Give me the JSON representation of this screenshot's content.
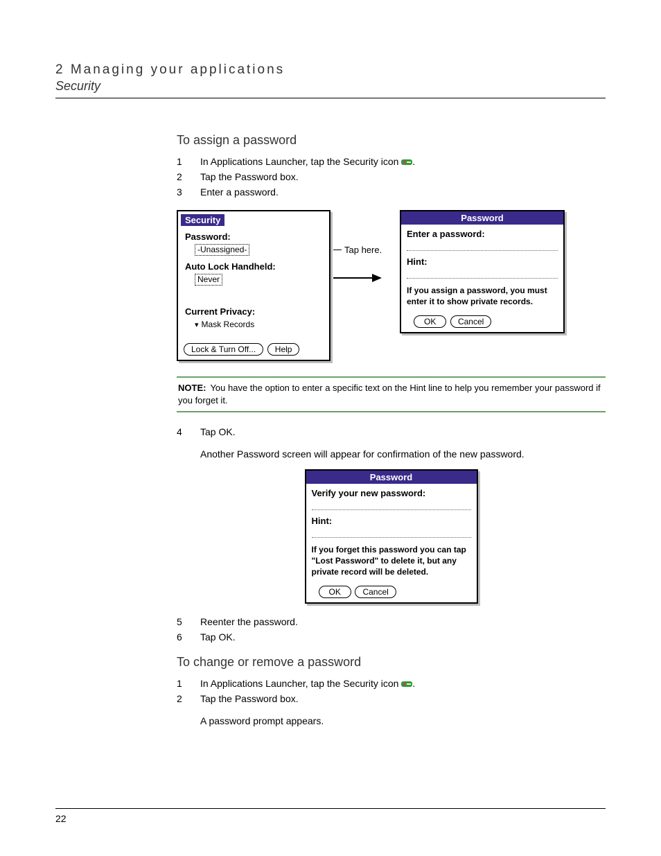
{
  "header": {
    "chapter": "2 Managing your applications",
    "section": "Security"
  },
  "s1": {
    "title": "To assign a password",
    "steps": {
      "n1": "1",
      "t1_a": "In Applications Launcher, tap the Security icon ",
      "t1_b": ".",
      "n2": "2",
      "t2": "Tap the Password box.",
      "n3": "3",
      "t3": "Enter a password."
    }
  },
  "fig1": {
    "callout_tap": "Tap here.",
    "security": {
      "title": "Security",
      "password_label": "Password:",
      "password_value": "-Unassigned-",
      "autolock_label": "Auto Lock Handheld:",
      "autolock_value": "Never",
      "privacy_label": "Current Privacy:",
      "privacy_value": "Mask Records",
      "lock_btn": "Lock & Turn Off...",
      "help_btn": "Help"
    },
    "password_dialog": {
      "title": "Password",
      "prompt": "Enter a password:",
      "hint_label": "Hint:",
      "info": "If you assign a password, you must enter it to show private records.",
      "ok": "OK",
      "cancel": "Cancel"
    }
  },
  "note": {
    "label": "NOTE:",
    "text": "You have the option to enter a specific text on the Hint line to help you remember your password if you forget it."
  },
  "s1b": {
    "n4": "4",
    "t4": "Tap OK.",
    "sub4": "Another Password screen will appear for confirmation of the new password."
  },
  "fig2": {
    "title": "Password",
    "prompt": "Verify your new password:",
    "hint_label": "Hint:",
    "info": "If you forget this password you can tap \"Lost Password\" to delete it, but any private record will be deleted.",
    "ok": "OK",
    "cancel": "Cancel"
  },
  "s1c": {
    "n5": "5",
    "t5": "Reenter the password.",
    "n6": "6",
    "t6": "Tap OK."
  },
  "s2": {
    "title": "To change or remove a password",
    "n1": "1",
    "t1_a": "In Applications Launcher, tap the Security icon ",
    "t1_b": ".",
    "n2": "2",
    "t2": "Tap the Password box.",
    "sub2": "A password prompt appears."
  },
  "page_number": "22"
}
